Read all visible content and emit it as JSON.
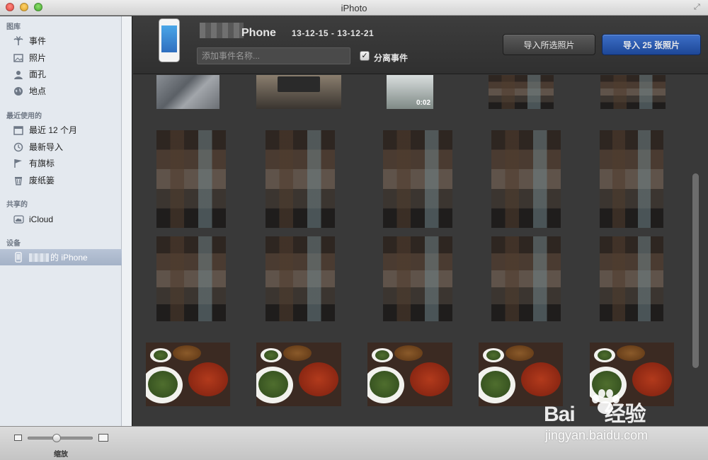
{
  "window": {
    "title": "iPhoto"
  },
  "sidebar": {
    "sections": [
      {
        "header": "图库",
        "items": [
          {
            "label": "事件",
            "icon": "palm-tree-icon"
          },
          {
            "label": "照片",
            "icon": "photos-icon"
          },
          {
            "label": "面孔",
            "icon": "faces-icon"
          },
          {
            "label": "地点",
            "icon": "globe-icon"
          }
        ]
      },
      {
        "header": "最近使用的",
        "items": [
          {
            "label": "最近 12 个月",
            "icon": "calendar-icon"
          },
          {
            "label": "最新导入",
            "icon": "clock-icon"
          },
          {
            "label": "有旗标",
            "icon": "flag-icon"
          },
          {
            "label": "废纸篓",
            "icon": "trash-icon"
          }
        ]
      },
      {
        "header": "共享的",
        "items": [
          {
            "label": "iCloud",
            "icon": "cloud-icon"
          }
        ]
      },
      {
        "header": "设备",
        "items": [
          {
            "label": "的 iPhone",
            "icon": "iphone-icon",
            "selected": true
          }
        ]
      }
    ]
  },
  "import": {
    "device_name": "Phone",
    "date_range": "13-12-15 - 13-12-21",
    "event_placeholder": "添加事件名称...",
    "split_events_label": "分离事件",
    "split_events_checked": true,
    "import_selected_label": "导入所选照片",
    "import_all_label": "导入 25 张照片"
  },
  "grid": {
    "video_duration": "0:02"
  },
  "bottom": {
    "zoom_label": "缩放",
    "zoom_level": 0.45
  },
  "watermark": {
    "brand": "Bai",
    "brand2": "经验",
    "url": "jingyan.baidu.com"
  }
}
